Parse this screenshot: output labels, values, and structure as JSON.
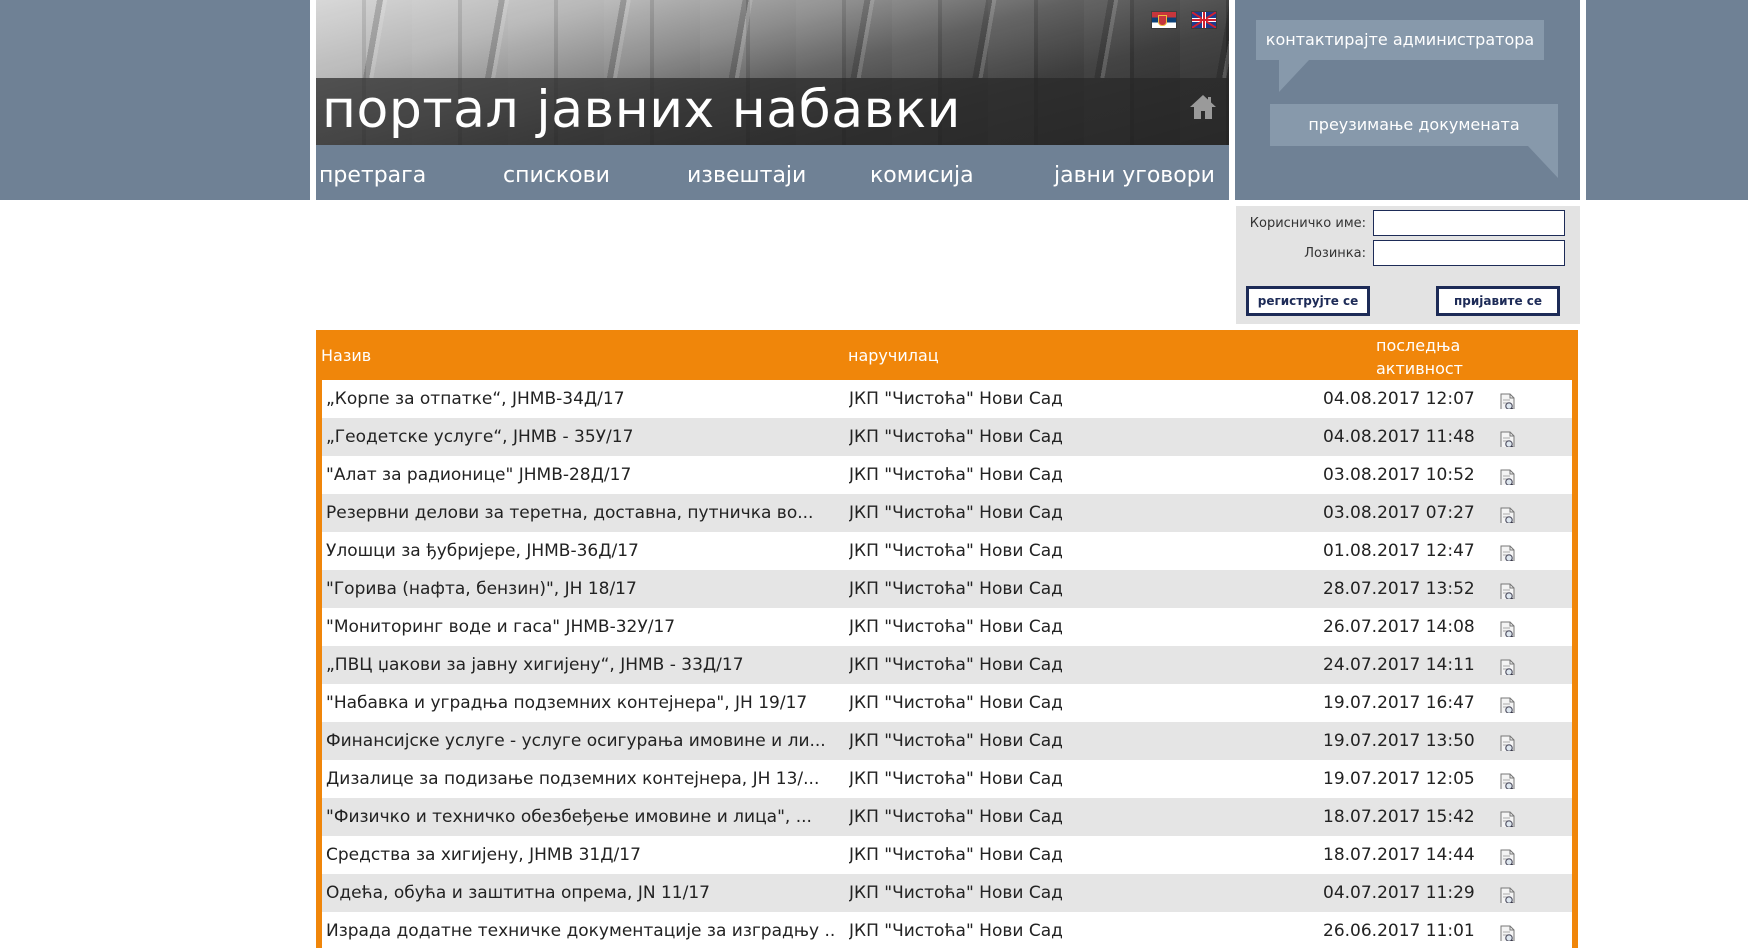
{
  "header": {
    "title": "портал јавних набавки",
    "flags": [
      "serbian-flag",
      "uk-flag"
    ],
    "home_icon": "home-icon"
  },
  "nav": {
    "items": [
      {
        "label": "претрага"
      },
      {
        "label": "спискови"
      },
      {
        "label": "извештаји"
      },
      {
        "label": "комисија"
      },
      {
        "label": "јавни уговори"
      }
    ]
  },
  "side": {
    "contact_label": "контактирајте администратора",
    "download_label": "преузимање докумената"
  },
  "login": {
    "username_label": "Корисничко име:",
    "password_label": "Лозинка:",
    "register_label": "региструјте се",
    "login_label": "пријавите се"
  },
  "table": {
    "headers": {
      "name": "Назив",
      "org": "наручилац",
      "activity_line1": "последња",
      "activity_line2": "активност"
    },
    "rows": [
      {
        "name": "„Корпе за отпатке“, ЈНМВ-34Д/17",
        "org": "ЈКП \"Чистоћа\" Нови Сад",
        "date": "04.08.2017 12:07"
      },
      {
        "name": "„Геодетске услуге“, ЈНМВ - 35У/17",
        "org": "ЈКП \"Чистоћа\" Нови Сад",
        "date": "04.08.2017 11:48"
      },
      {
        "name": "\"Алат за радионице\" ЈНМВ-28Д/17",
        "org": "ЈКП \"Чистоћа\" Нови Сад",
        "date": "03.08.2017 10:52"
      },
      {
        "name": "Резервни делови за теретна, доставна, путничка во...",
        "org": "ЈКП \"Чистоћа\" Нови Сад",
        "date": "03.08.2017 07:27"
      },
      {
        "name": "Улошци за ђубријере, ЈНМВ-36Д/17",
        "org": "ЈКП \"Чистоћа\" Нови Сад",
        "date": "01.08.2017 12:47"
      },
      {
        "name": "\"Горива (нафта, бензин)\", ЈН 18/17",
        "org": "ЈКП \"Чистоћа\" Нови Сад",
        "date": "28.07.2017 13:52"
      },
      {
        "name": "\"Мониторинг воде и гаса\" ЈНМВ-32У/17",
        "org": "ЈКП \"Чистоћа\" Нови Сад",
        "date": "26.07.2017 14:08"
      },
      {
        "name": "„ПВЦ џакови за јавну хигијену“, ЈНМВ - 33Д/17",
        "org": "ЈКП \"Чистоћа\" Нови Сад",
        "date": "24.07.2017 14:11"
      },
      {
        "name": "\"Набавка и уградња подземних контејнера\", ЈН 19/17",
        "org": "ЈКП \"Чистоћа\" Нови Сад",
        "date": "19.07.2017 16:47"
      },
      {
        "name": "Финансијске услуге - услуге осигурања имовине и ли...",
        "org": "ЈКП \"Чистоћа\" Нови Сад",
        "date": "19.07.2017 13:50"
      },
      {
        "name": "Дизалице за подизање подземних контејнера, ЈН 13/...",
        "org": "ЈКП \"Чистоћа\" Нови Сад",
        "date": "19.07.2017 12:05"
      },
      {
        "name": "\"Физичко и техничко обезбеђење имовине и лица\", ...",
        "org": "ЈКП \"Чистоћа\" Нови Сад",
        "date": "18.07.2017 15:42"
      },
      {
        "name": "Средства за хигијену, ЈНМВ 31Д/17",
        "org": "ЈКП \"Чистоћа\" Нови Сад",
        "date": "18.07.2017 14:44"
      },
      {
        "name": "Одећа, обућа и заштитна опрема, JN 11/17",
        "org": "ЈКП \"Чистоћа\" Нови Сад",
        "date": "04.07.2017 11:29"
      },
      {
        "name": "Израда додатне техничке документације за изградњу ...",
        "org": "ЈКП \"Чистоћа\" Нови Сад",
        "date": "26.06.2017 11:01"
      }
    ]
  },
  "colors": {
    "band": "#6f8195",
    "table_header": "#f0860a",
    "button_border": "#1d2b57"
  }
}
